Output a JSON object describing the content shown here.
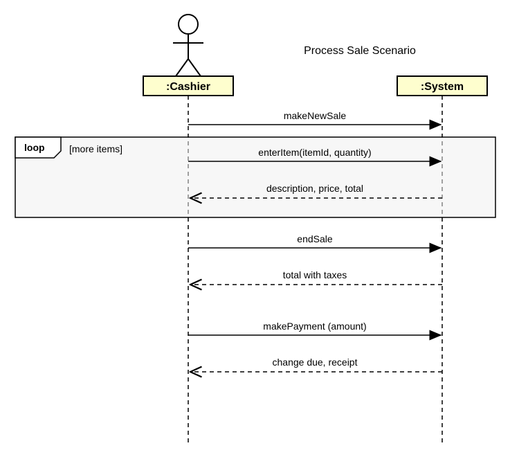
{
  "title": "Process Sale Scenario",
  "participants": {
    "cashier": ":Cashier",
    "system": ":System"
  },
  "fragment": {
    "kind": "loop",
    "guard": "[more items]"
  },
  "messages": {
    "m1": "makeNewSale",
    "m2": "enterItem(itemId, quantity)",
    "m3": "description, price, total",
    "m4": "endSale",
    "m5": "total with taxes",
    "m6": "makePayment (amount)",
    "m7": "change due, receipt"
  }
}
